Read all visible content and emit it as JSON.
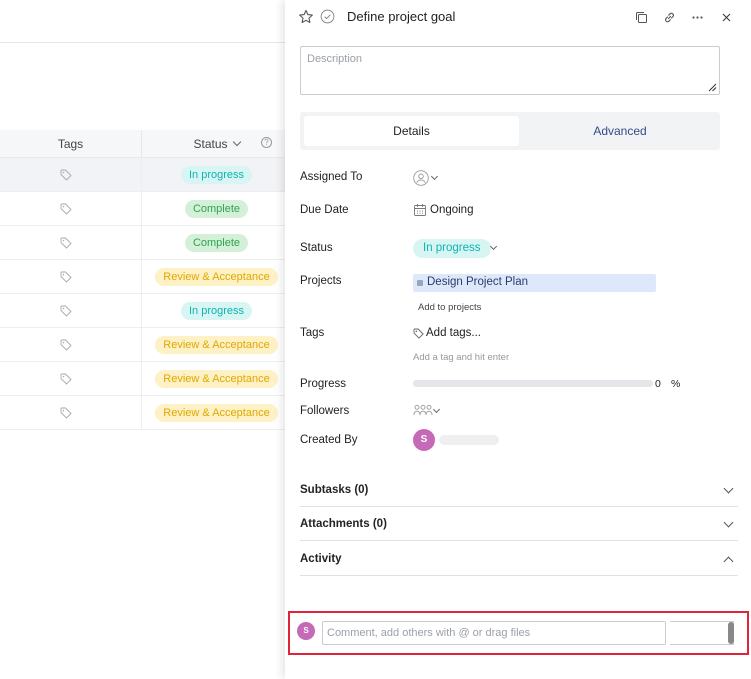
{
  "table": {
    "col_tags": "Tags",
    "col_status": "Status",
    "rows": [
      {
        "status": "In progress",
        "kind": "inprog"
      },
      {
        "status": "Complete",
        "kind": "complete"
      },
      {
        "status": "Complete",
        "kind": "complete"
      },
      {
        "status": "Review & Acceptance",
        "kind": "review"
      },
      {
        "status": "In progress",
        "kind": "inprog"
      },
      {
        "status": "Review & Acceptance",
        "kind": "review"
      },
      {
        "status": "Review & Acceptance",
        "kind": "review"
      },
      {
        "status": "Review & Acceptance",
        "kind": "review"
      }
    ]
  },
  "panel": {
    "title": "Define project goal",
    "description_placeholder": "Description",
    "tabs": {
      "details": "Details",
      "advanced": "Advanced"
    },
    "fields": {
      "assigned_to": "Assigned To",
      "due_date": "Due Date",
      "due_date_value": "Ongoing",
      "status": "Status",
      "status_value": "In progress",
      "projects": "Projects",
      "project_value": "Design Project Plan",
      "add_to_projects": "Add to projects",
      "tags": "Tags",
      "add_tags": "Add tags...",
      "tag_hint": "Add a tag and hit enter",
      "progress": "Progress",
      "progress_value": "0",
      "progress_unit": "%",
      "followers": "Followers",
      "created_by": "Created By",
      "creator_initial": "S"
    },
    "sections": {
      "subtasks": "Subtasks (0)",
      "attachments": "Attachments (0)",
      "activity": "Activity"
    },
    "comment": {
      "avatar_initial": "S",
      "placeholder": "Comment, add others with @ or drag files"
    }
  },
  "colors": {
    "accent_teal": "#0fb3b0",
    "complete_green": "#2ea44f",
    "review_yellow": "#e0a800",
    "avatar_purple": "#c46ab6",
    "highlight_red": "#e0223a"
  }
}
